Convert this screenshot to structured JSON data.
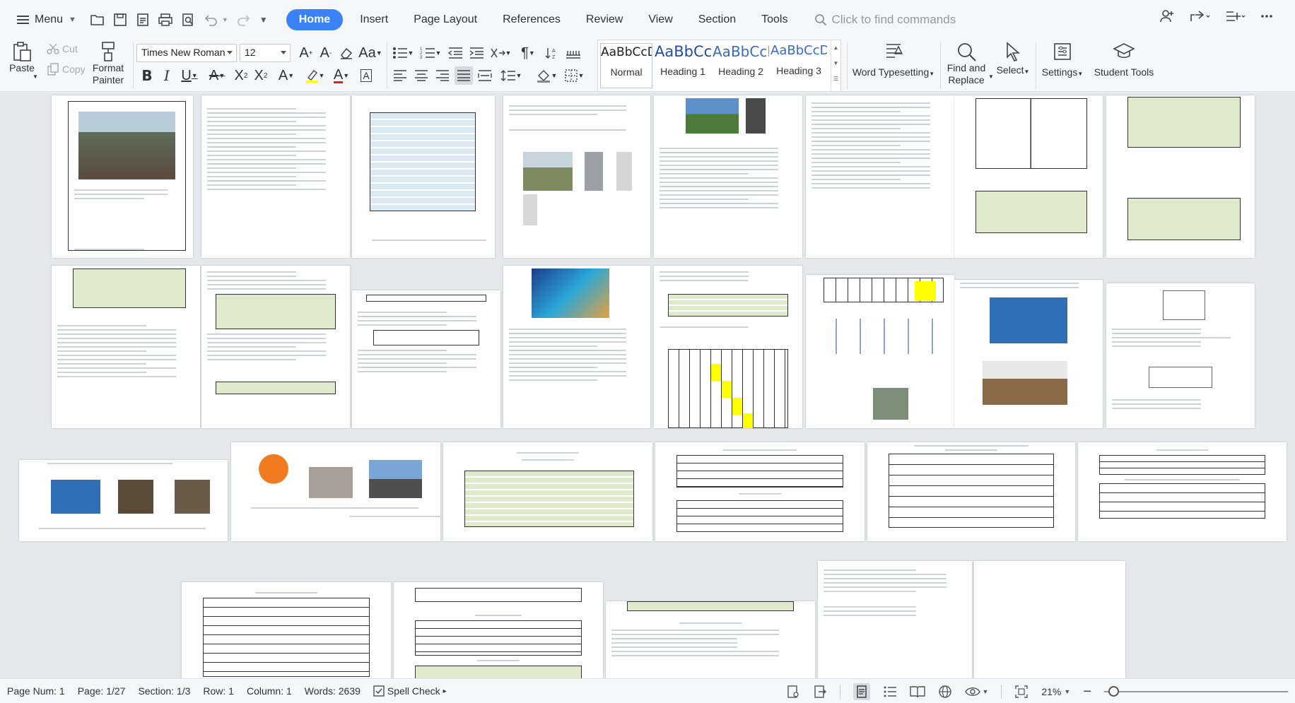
{
  "menubar": {
    "menu_label": "Menu",
    "tabs": [
      {
        "label": "Home",
        "active": true
      },
      {
        "label": "Insert"
      },
      {
        "label": "Page Layout"
      },
      {
        "label": "References"
      },
      {
        "label": "Review"
      },
      {
        "label": "View"
      },
      {
        "label": "Section"
      },
      {
        "label": "Tools"
      }
    ],
    "search_placeholder": "Click to find commands"
  },
  "ribbon": {
    "paste": "Paste",
    "cut": "Cut",
    "copy": "Copy",
    "format_painter": "Format Painter",
    "font_name": "Times New Roman",
    "font_size": "12",
    "styles": [
      {
        "sample": "AaBbCcDd",
        "name": "Normal"
      },
      {
        "sample": "AaBbCcI",
        "name": "Heading 1"
      },
      {
        "sample": "AaBbCcI",
        "name": "Heading 2"
      },
      {
        "sample": "AaBbCcDd",
        "name": "Heading 3"
      }
    ],
    "word_typesetting": "Word Typesetting",
    "find_replace": "Find and Replace",
    "select": "Select",
    "settings": "Settings",
    "student_tools": "Student Tools"
  },
  "status": {
    "page_num": "Page Num: 1",
    "page": "Page: 1/27",
    "section": "Section: 1/3",
    "row": "Row: 1",
    "column": "Column: 1",
    "words": "Words: 2639",
    "spell_check": "Spell Check",
    "zoom": "21%"
  },
  "colors": {
    "accent": "#3b82f6",
    "heading_blue": "#1f4ea3",
    "table_green": "#dfeacc",
    "highlight_yellow": "#ffff00"
  }
}
